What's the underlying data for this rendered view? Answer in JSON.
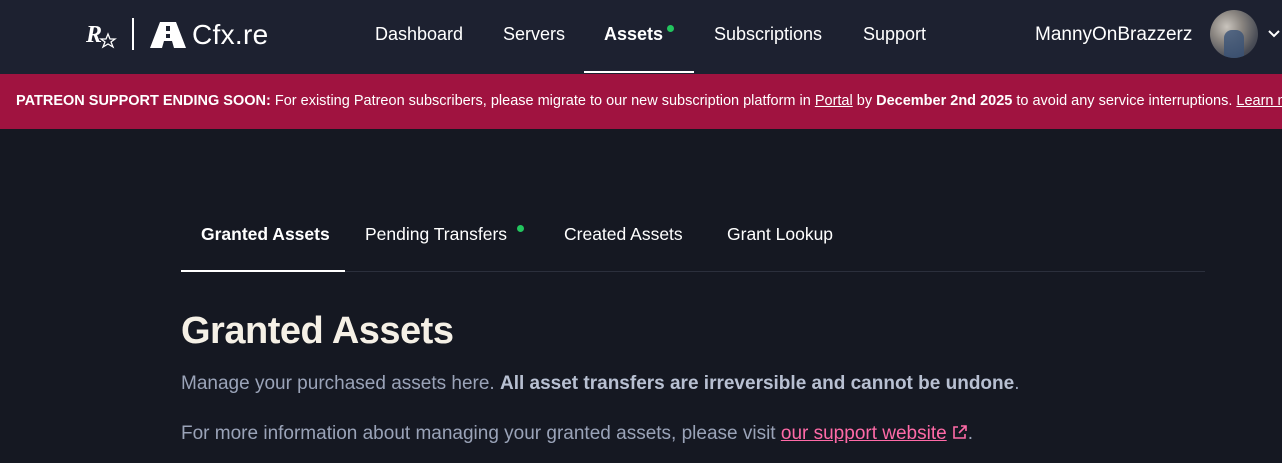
{
  "header": {
    "brand_text": "Cfx.re",
    "nav": [
      {
        "label": "Dashboard",
        "active": false
      },
      {
        "label": "Servers",
        "active": false
      },
      {
        "label": "Assets",
        "active": true,
        "indicator": true
      },
      {
        "label": "Subscriptions",
        "active": false
      },
      {
        "label": "Support",
        "active": false
      }
    ],
    "username": "MannyOnBrazzerz"
  },
  "banner": {
    "title": "PATREON SUPPORT ENDING SOON:",
    "text_before_link": " For existing Patreon subscribers, please migrate to our new subscription platform in ",
    "link_text": "Portal",
    "text_by": " by ",
    "deadline": "December 2nd 2025",
    "text_after": " to avoid any service interruptions. ",
    "learn_more": "Learn more",
    "background": "#a01340"
  },
  "tabs": [
    {
      "label": "Granted Assets",
      "active": true
    },
    {
      "label": "Pending Transfers",
      "indicator": true
    },
    {
      "label": "Created Assets"
    },
    {
      "label": "Grant Lookup"
    }
  ],
  "main": {
    "title": "Granted Assets",
    "desc1_plain": "Manage your purchased assets here. ",
    "desc1_bold": "All asset transfers are irreversible and cannot be undone",
    "desc1_end": ".",
    "desc2_plain": "For more information about managing your granted assets, please visit ",
    "desc2_link": "our support website",
    "desc2_end": "."
  },
  "colors": {
    "accent_link": "#ff6aa7",
    "indicator": "#22c55e",
    "page_bg": "#151822",
    "header_bg": "#1d2130"
  },
  "icons": [
    "rockstar-logo-icon",
    "cfx-logo-icon",
    "chevron-down-icon",
    "external-link-icon"
  ]
}
